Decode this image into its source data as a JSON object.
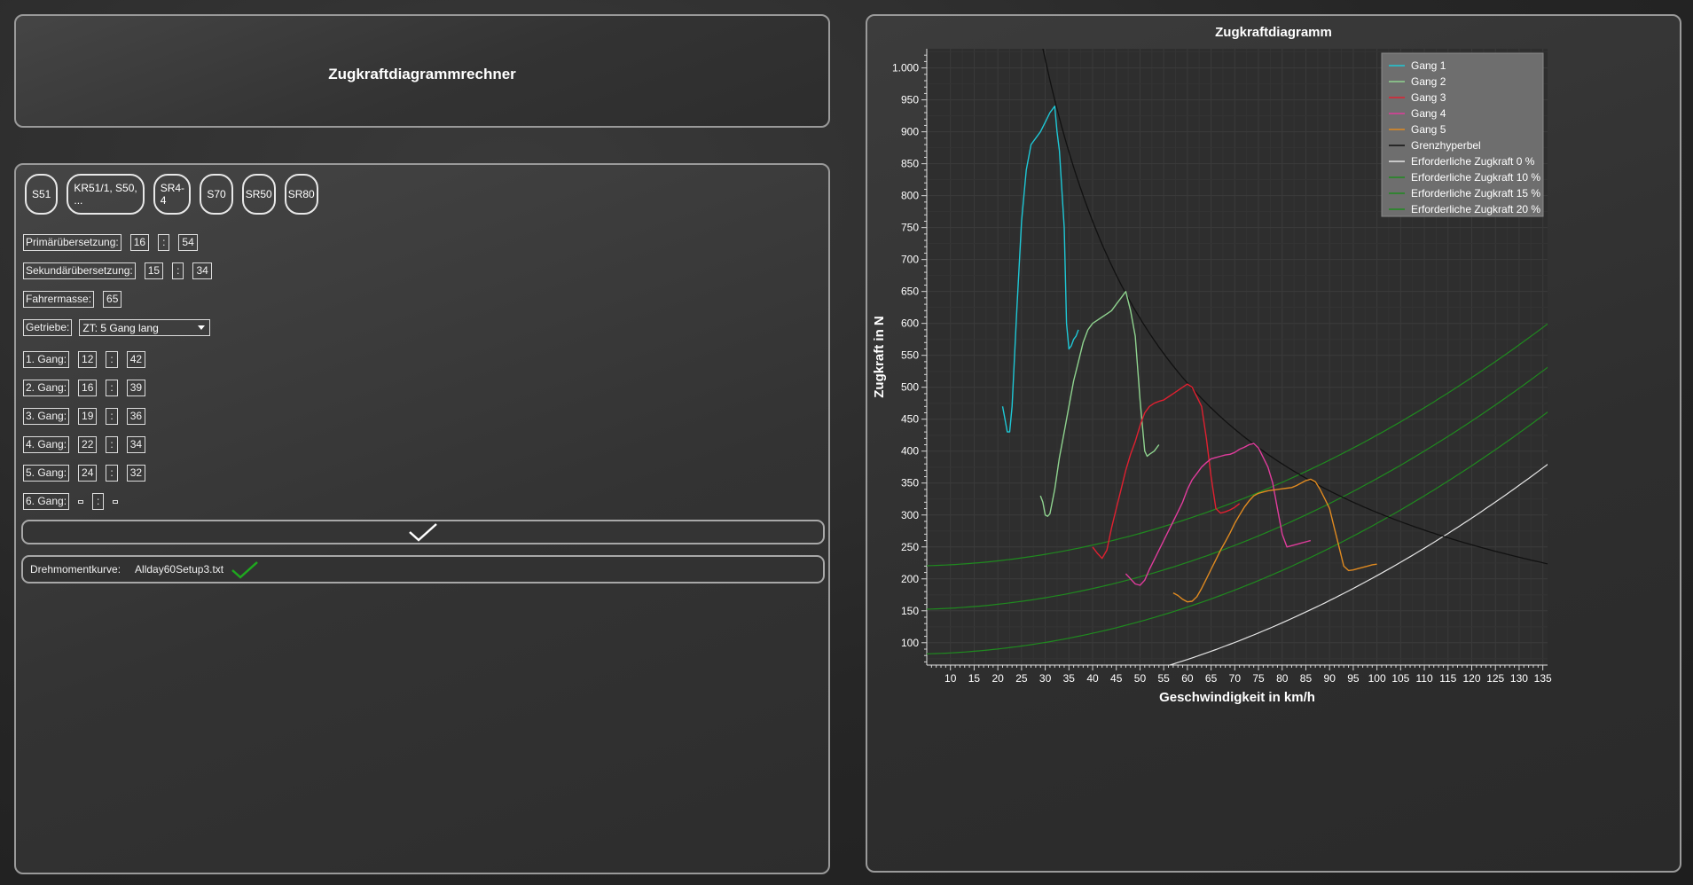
{
  "app": {
    "title": "Zugkraftdiagrammrechner"
  },
  "models": [
    "S51",
    "KR51/1, S50, ...",
    "SR4-4",
    "S70",
    "SR50",
    "SR80"
  ],
  "form": {
    "primary": {
      "label": "Primärübersetzung:",
      "a": "16",
      "b": "54"
    },
    "secondary": {
      "label": "Sekundärübersetzung:",
      "a": "15",
      "b": "34"
    },
    "rider_mass": {
      "label": "Fahrermasse:",
      "value": "65"
    },
    "gearbox": {
      "label": "Getriebe:",
      "selected": "ZT: 5 Gang lang"
    },
    "separator": ":",
    "gears": [
      {
        "label": "1. Gang:",
        "a": "12",
        "b": "42"
      },
      {
        "label": "2. Gang:",
        "a": "16",
        "b": "39"
      },
      {
        "label": "3. Gang:",
        "a": "19",
        "b": "36"
      },
      {
        "label": "4. Gang:",
        "a": "22",
        "b": "34"
      },
      {
        "label": "5. Gang:",
        "a": "24",
        "b": "32"
      },
      {
        "label": "6. Gang:",
        "a": "",
        "b": ""
      }
    ],
    "confirm_icon": "checkmark-icon",
    "torque_curve": {
      "label": "Drehmomentkurve:",
      "file": "Allday60Setup3.txt",
      "status_icon": "green-checkmark-icon"
    }
  },
  "chart_data": {
    "type": "line",
    "title": "Zugkraftdiagramm",
    "xlabel": "Geschwindigkeit in km/h",
    "ylabel": "Zugkraft in N",
    "xlim": [
      5,
      136
    ],
    "ylim": [
      65,
      1030
    ],
    "xticks": [
      10,
      15,
      20,
      25,
      30,
      35,
      40,
      45,
      50,
      55,
      60,
      65,
      70,
      75,
      80,
      85,
      90,
      95,
      100,
      105,
      110,
      115,
      120,
      125,
      130,
      135
    ],
    "yticks": [
      100,
      150,
      200,
      250,
      300,
      350,
      400,
      450,
      500,
      550,
      600,
      650,
      700,
      750,
      800,
      850,
      900,
      950,
      1000
    ],
    "ytick_labels": [
      "100",
      "150",
      "200",
      "250",
      "300",
      "350",
      "400",
      "450",
      "500",
      "550",
      "600",
      "650",
      "700",
      "750",
      "800",
      "850",
      "900",
      "950",
      "1.000"
    ],
    "grid": true,
    "legend_position": "top-right",
    "hyperbola_constant": 30400,
    "required_base": {
      "0 %": 0,
      "10 %": 82,
      "15 %": 152,
      "20 %": 220
    },
    "required_slope": 0.0205,
    "series": [
      {
        "name": "Gang 1",
        "color": "#1ec8d6",
        "x": [
          21,
          21.5,
          22,
          22.5,
          23,
          24,
          25,
          26,
          27,
          28,
          29,
          30,
          31,
          32,
          32.5,
          33,
          34,
          34.5,
          35,
          35.5,
          36,
          36.5,
          37
        ],
        "y": [
          470,
          450,
          430,
          430,
          470,
          620,
          760,
          840,
          880,
          890,
          900,
          915,
          930,
          940,
          900,
          870,
          750,
          600,
          560,
          565,
          575,
          580,
          590
        ]
      },
      {
        "name": "Gang 2",
        "color": "#8fd38f",
        "x": [
          29,
          29.5,
          30,
          30.5,
          31,
          32,
          33,
          34,
          35,
          36,
          37,
          38,
          39,
          40,
          41,
          42,
          43,
          44,
          45,
          46,
          47,
          48,
          49,
          50,
          51,
          51.5,
          52,
          53,
          54
        ],
        "y": [
          330,
          320,
          300,
          298,
          302,
          340,
          390,
          430,
          470,
          510,
          540,
          570,
          590,
          600,
          605,
          610,
          615,
          620,
          630,
          640,
          650,
          620,
          580,
          480,
          400,
          392,
          395,
          400,
          410
        ]
      },
      {
        "name": "Gang 3",
        "color": "#e02030",
        "x": [
          40,
          41,
          42,
          43,
          44,
          45,
          46,
          47,
          48,
          49,
          50,
          51,
          52,
          53,
          54,
          55,
          56,
          57,
          58,
          59,
          60,
          61,
          62,
          63,
          64,
          65,
          66,
          67,
          68,
          69,
          70,
          71
        ],
        "y": [
          250,
          240,
          232,
          245,
          280,
          310,
          340,
          370,
          395,
          415,
          440,
          460,
          470,
          475,
          478,
          480,
          485,
          490,
          495,
          500,
          505,
          500,
          485,
          470,
          420,
          360,
          310,
          303,
          305,
          308,
          312,
          318
        ]
      },
      {
        "name": "Gang 4",
        "color": "#e03c9c",
        "x": [
          47,
          48,
          49,
          50,
          51,
          52,
          53,
          54,
          55,
          56,
          57,
          58,
          59,
          60,
          61,
          62,
          63,
          64,
          65,
          66,
          67,
          68,
          69,
          70,
          71,
          72,
          73,
          74,
          75,
          76,
          77,
          78,
          79,
          80,
          81,
          82,
          83,
          84,
          85,
          86
        ],
        "y": [
          208,
          200,
          192,
          190,
          198,
          215,
          230,
          245,
          260,
          275,
          290,
          305,
          320,
          340,
          355,
          365,
          375,
          382,
          388,
          390,
          392,
          394,
          395,
          398,
          403,
          406,
          410,
          412,
          405,
          390,
          375,
          350,
          310,
          270,
          250,
          252,
          254,
          256,
          258,
          260
        ]
      },
      {
        "name": "Gang 5",
        "color": "#e08a20",
        "x": [
          57,
          58,
          59,
          60,
          61,
          62,
          63,
          64,
          65,
          66,
          67,
          68,
          69,
          70,
          71,
          72,
          73,
          74,
          75,
          76,
          77,
          78,
          79,
          80,
          81,
          82,
          83,
          84,
          85,
          86,
          87,
          88,
          89,
          90,
          91,
          92,
          93,
          94,
          95,
          96,
          97,
          98,
          99,
          100
        ],
        "y": [
          178,
          174,
          168,
          164,
          165,
          172,
          185,
          200,
          215,
          230,
          245,
          258,
          272,
          287,
          300,
          312,
          322,
          330,
          334,
          336,
          338,
          339,
          340,
          341,
          342,
          343,
          346,
          350,
          354,
          356,
          352,
          340,
          325,
          310,
          280,
          250,
          220,
          213,
          214,
          216,
          218,
          220,
          222,
          223
        ]
      },
      {
        "name": "Grenzhyperbel",
        "color": "#111111"
      },
      {
        "name": "Erforderliche Zugkraft 0 %",
        "color": "#e6e6e6"
      },
      {
        "name": "Erforderliche Zugkraft 10 %",
        "color": "#1f8a1f"
      },
      {
        "name": "Erforderliche Zugkraft 15 %",
        "color": "#1f8a1f"
      },
      {
        "name": "Erforderliche Zugkraft 20 %",
        "color": "#1f8a1f"
      }
    ]
  }
}
